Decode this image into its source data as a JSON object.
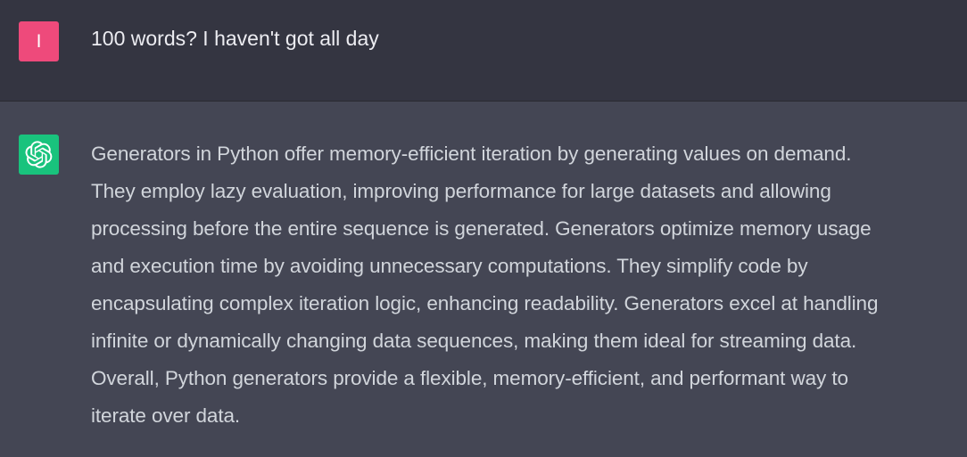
{
  "colors": {
    "user_row_bg": "#343541",
    "assistant_row_bg": "#444654",
    "user_avatar_bg": "#ee4a7b",
    "assistant_avatar_bg": "#19c37d"
  },
  "user_message": {
    "avatar_letter": "I",
    "text": "100 words? I haven't got all day"
  },
  "assistant_message": {
    "avatar_icon": "openai-logo-icon",
    "lines": [
      "Generators in Python offer memory-efficient iteration by generating values on demand.",
      "They employ lazy evaluation, improving performance for large datasets and allowing",
      "processing before the entire sequence is generated. Generators optimize memory usage",
      "and execution time by avoiding unnecessary computations. They simplify code by",
      "encapsulating complex iteration logic, enhancing readability. Generators excel at handling",
      "infinite or dynamically changing data sequences, making them ideal for streaming data.",
      "Overall, Python generators provide a flexible, memory-efficient, and performant way to",
      "iterate over data."
    ]
  }
}
